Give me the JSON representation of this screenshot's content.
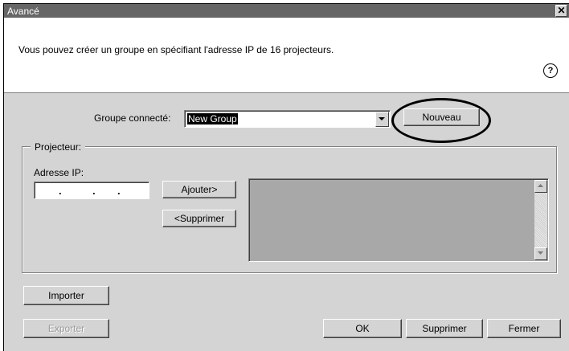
{
  "window": {
    "title": "Avancé",
    "close_glyph": "✕"
  },
  "info": {
    "text": "Vous pouvez créer un groupe en spécifiant l'adresse IP de 16 projecteurs.",
    "help_glyph": "?"
  },
  "group": {
    "label": "Groupe connecté:",
    "selected": "New Group",
    "new_button": "Nouveau"
  },
  "projector": {
    "legend": "Projecteur:",
    "ip_label": "Adresse IP:",
    "ip_dots": [
      ".",
      ".",
      "."
    ],
    "add_button": "Ajouter>",
    "remove_button": "<Supprimer"
  },
  "footer": {
    "import_button": "Importer",
    "export_button": "Exporter",
    "ok_button": "OK",
    "delete_button": "Supprimer",
    "close_button": "Fermer"
  },
  "colors": {
    "titlebar": "#666666",
    "dialog_bg": "#d4d4d4",
    "list_bg": "#a8a8a8",
    "highlight": "#000000"
  },
  "icons": {
    "close": "close-icon",
    "help": "help-icon",
    "dropdown": "chevron-down-icon",
    "scroll_up": "arrow-up-icon",
    "scroll_down": "arrow-down-icon"
  }
}
